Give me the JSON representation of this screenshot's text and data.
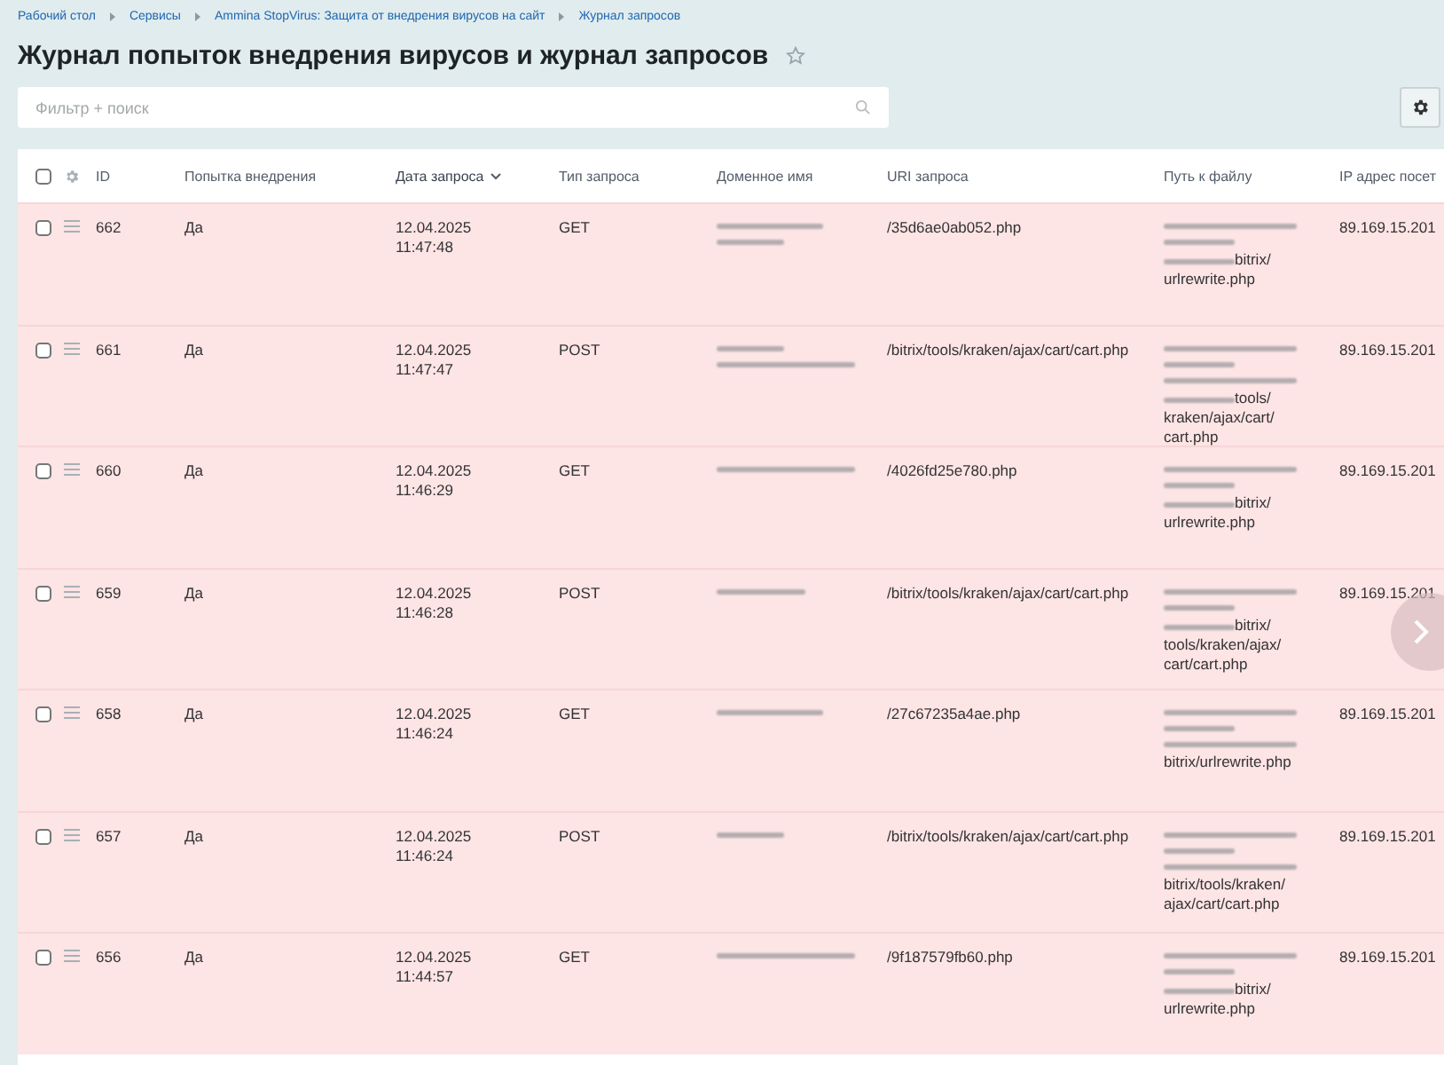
{
  "breadcrumbs": [
    "Рабочий стол",
    "Сервисы",
    "Ammina StopVirus: Защита от внедрения вирусов на сайт",
    "Журнал запросов"
  ],
  "title": "Журнал попыток внедрения вирусов и журнал запросов",
  "favorite": false,
  "search": {
    "placeholder": "Фильтр + поиск"
  },
  "table": {
    "select_all_checked": false,
    "columns": [
      {
        "label": "ID",
        "sorted": false
      },
      {
        "label": "Попытка внедрения",
        "sorted": false
      },
      {
        "label": "Дата запроса",
        "sorted": true
      },
      {
        "label": "Тип запроса",
        "sorted": false
      },
      {
        "label": "Доменное имя",
        "sorted": false
      },
      {
        "label": "URI запроса",
        "sorted": false
      },
      {
        "label": "Путь к файлу",
        "sorted": false
      },
      {
        "label": "IP адрес посет",
        "sorted": false
      }
    ],
    "rows": [
      {
        "checked": false,
        "id": "662",
        "attempt": "Да",
        "date": "12.04.2025",
        "time": "11:47:48",
        "type": "GET",
        "domain": [
          {
            "kind": "redacted"
          },
          {
            "kind": "redacted"
          }
        ],
        "uri": "/35d6ae0ab052.php",
        "path": [
          {
            "kind": "redacted"
          },
          {
            "kind": "redacted"
          },
          {
            "kind": "partial",
            "text": "bitrix/"
          },
          {
            "kind": "text",
            "text": "urlrewrite.php"
          }
        ],
        "ip": "89.169.15.201"
      },
      {
        "checked": false,
        "id": "661",
        "attempt": "Да",
        "date": "12.04.2025",
        "time": "11:47:47",
        "type": "POST",
        "domain": [
          {
            "kind": "redacted"
          },
          {
            "kind": "redacted"
          }
        ],
        "uri": "/bitrix/tools/kraken/ajax/cart/cart.php",
        "path": [
          {
            "kind": "redacted"
          },
          {
            "kind": "redacted"
          },
          {
            "kind": "redacted"
          },
          {
            "kind": "partial",
            "text": "tools/"
          },
          {
            "kind": "text",
            "text": "kraken/ajax/cart/"
          },
          {
            "kind": "text",
            "text": "cart.php"
          }
        ],
        "ip": "89.169.15.201"
      },
      {
        "checked": false,
        "id": "660",
        "attempt": "Да",
        "date": "12.04.2025",
        "time": "11:46:29",
        "type": "GET",
        "domain": [
          {
            "kind": "redacted"
          }
        ],
        "uri": "/4026fd25e780.php",
        "path": [
          {
            "kind": "redacted"
          },
          {
            "kind": "redacted"
          },
          {
            "kind": "partial",
            "text": "bitrix/"
          },
          {
            "kind": "text",
            "text": "urlrewrite.php"
          }
        ],
        "ip": "89.169.15.201"
      },
      {
        "checked": false,
        "id": "659",
        "attempt": "Да",
        "date": "12.04.2025",
        "time": "11:46:28",
        "type": "POST",
        "domain": [
          {
            "kind": "redacted"
          }
        ],
        "uri": "/bitrix/tools/kraken/ajax/cart/cart.php",
        "path": [
          {
            "kind": "redacted"
          },
          {
            "kind": "redacted"
          },
          {
            "kind": "partial",
            "text": "bitrix/"
          },
          {
            "kind": "text",
            "text": "tools/kraken/ajax/"
          },
          {
            "kind": "text",
            "text": "cart/cart.php"
          }
        ],
        "ip": "89.169.15.201"
      },
      {
        "checked": false,
        "id": "658",
        "attempt": "Да",
        "date": "12.04.2025",
        "time": "11:46:24",
        "type": "GET",
        "domain": [
          {
            "kind": "redacted"
          }
        ],
        "uri": "/27c67235a4ae.php",
        "path": [
          {
            "kind": "redacted"
          },
          {
            "kind": "redacted"
          },
          {
            "kind": "redacted"
          },
          {
            "kind": "text",
            "text": "bitrix/urlrewrite.php"
          }
        ],
        "ip": "89.169.15.201"
      },
      {
        "checked": false,
        "id": "657",
        "attempt": "Да",
        "date": "12.04.2025",
        "time": "11:46:24",
        "type": "POST",
        "domain": [
          {
            "kind": "redacted"
          }
        ],
        "uri": "/bitrix/tools/kraken/ajax/cart/cart.php",
        "path": [
          {
            "kind": "redacted"
          },
          {
            "kind": "redacted"
          },
          {
            "kind": "redacted"
          },
          {
            "kind": "text",
            "text": "bitrix/tools/kraken/"
          },
          {
            "kind": "text",
            "text": "ajax/cart/cart.php"
          }
        ],
        "ip": "89.169.15.201"
      },
      {
        "checked": false,
        "id": "656",
        "attempt": "Да",
        "date": "12.04.2025",
        "time": "11:44:57",
        "type": "GET",
        "domain": [
          {
            "kind": "redacted"
          }
        ],
        "uri": "/9f187579fb60.php",
        "path": [
          {
            "kind": "redacted"
          },
          {
            "kind": "redacted"
          },
          {
            "kind": "partial",
            "text": "bitrix/"
          },
          {
            "kind": "text",
            "text": "urlrewrite.php"
          }
        ],
        "ip": "89.169.15.201"
      }
    ]
  }
}
